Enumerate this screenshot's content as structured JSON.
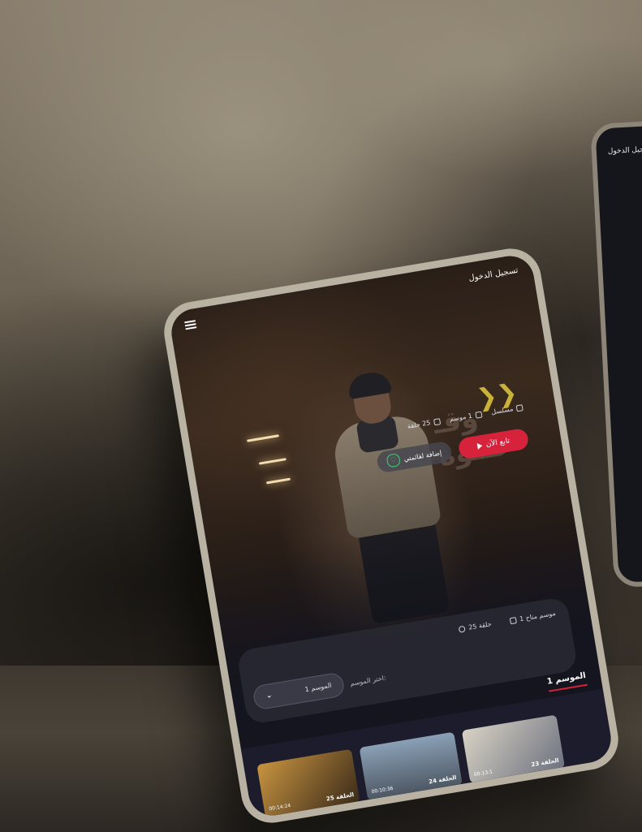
{
  "header": {
    "login_label": "تسجيل الدخول"
  },
  "second_tablet": {
    "login_label": "تسجيل الدخول"
  },
  "show": {
    "type_label": "مسلسل",
    "seasons_label": "1 موسم",
    "episodes_label": "25 حلقة",
    "watch_label": "تابع الآن",
    "add_list_label": "إضافة لقائمتي",
    "logo_text": "وقـ\nطـوة",
    "colors": {
      "accent": "#d6223b",
      "heart": "#3fd178"
    }
  },
  "season_bar": {
    "seasons_available": "1 موسم متاح",
    "episode_count": "25 حلقة",
    "choose_label": "اختر الموسم:",
    "selected_season": "الموسم 1",
    "season_tab": "الموسم 1"
  },
  "episodes": [
    {
      "label": "الحلقة 25",
      "duration": "00:14:24"
    },
    {
      "label": "الحلقة 24",
      "duration": "00:10:36"
    },
    {
      "label": "الحلقة 23",
      "duration": "00:13:1"
    }
  ]
}
